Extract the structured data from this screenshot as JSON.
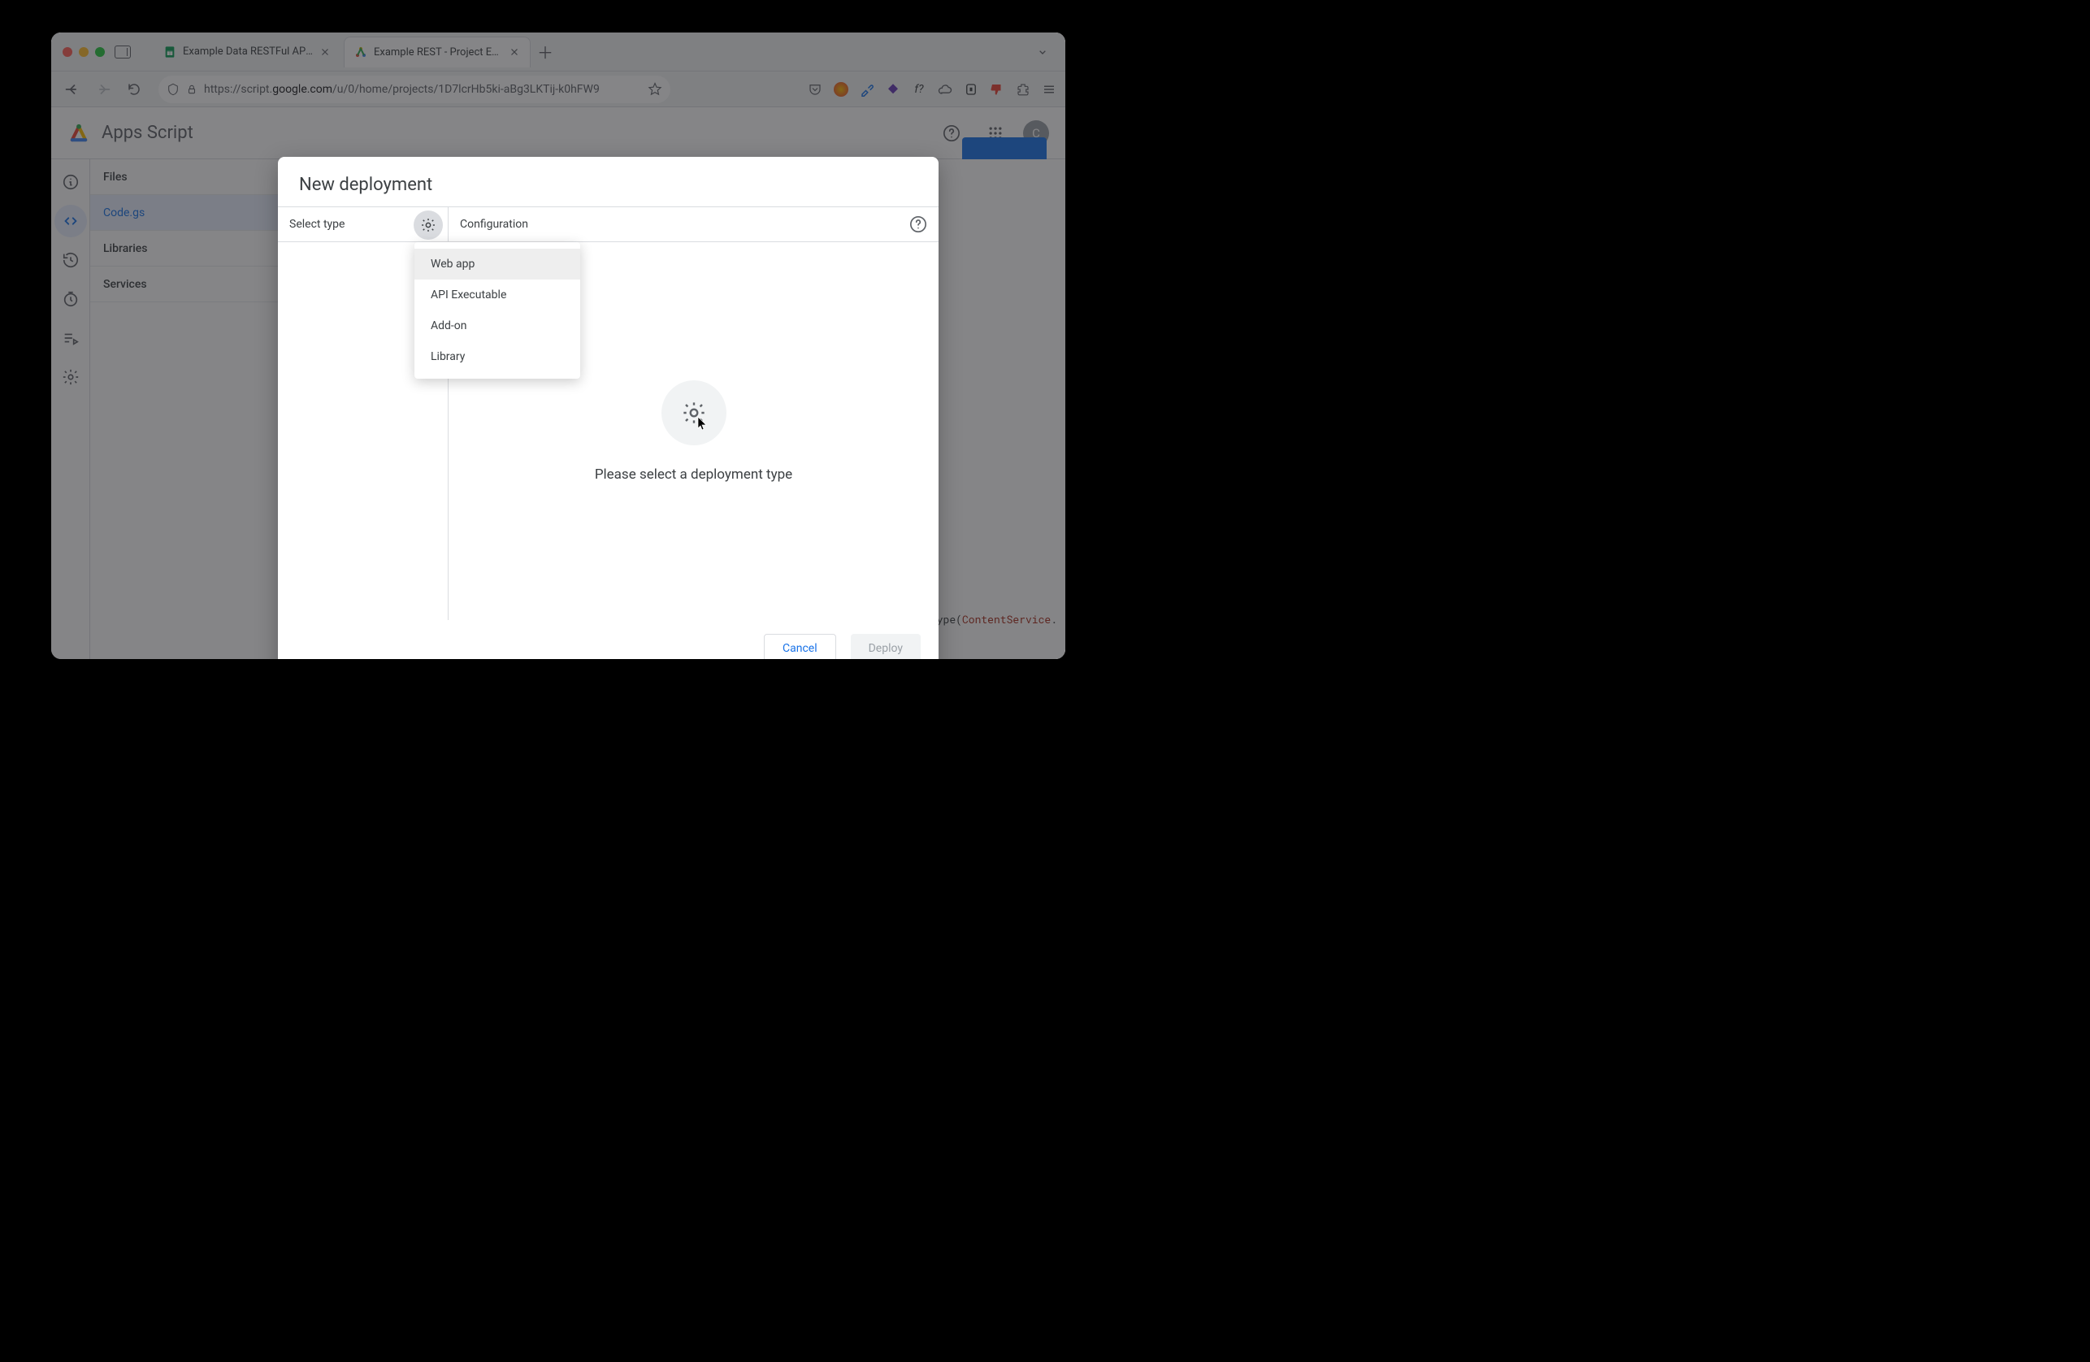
{
  "browser": {
    "tabs": [
      {
        "title": "Example Data RESTFul API - Go",
        "favicon": "sheets"
      },
      {
        "title": "Example REST - Project Editor -",
        "favicon": "apps-script"
      }
    ],
    "url_prefix": "https://script.",
    "url_domain": "google.com",
    "url_path": "/u/0/home/projects/1D7lcrHb5ki-aBg3LKTij-k0hFW9",
    "ext_f": "f?"
  },
  "app": {
    "title": "Apps Script",
    "avatar_initial": "C"
  },
  "sidebar": {
    "sections": [
      "Files",
      "Libraries",
      "Services"
    ],
    "file": "Code.gs"
  },
  "modal": {
    "title": "New deployment",
    "select_type": "Select type",
    "configuration": "Configuration",
    "placeholder": "Please select a deployment type",
    "dropdown": [
      "Web app",
      "API Executable",
      "Add-on",
      "Library"
    ],
    "cancel": "Cancel",
    "deploy": "Deploy"
  },
  "code_fragment": {
    "a": "imeType(",
    "b": "ContentService",
    "c": "."
  }
}
